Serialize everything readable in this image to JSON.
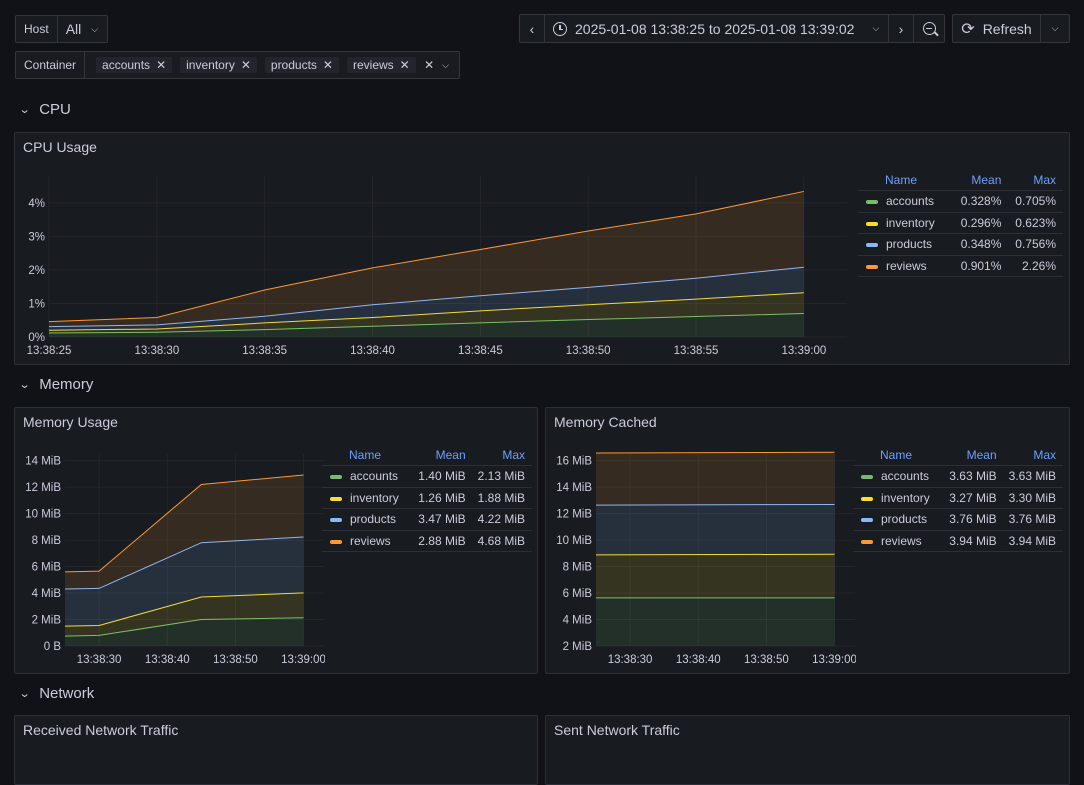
{
  "variables": {
    "host": {
      "label": "Host",
      "value": "All"
    },
    "container": {
      "label": "Container",
      "values": [
        "accounts",
        "inventory",
        "products",
        "reviews"
      ]
    }
  },
  "time_picker": {
    "range": "2025-01-08 13:38:25 to 2025-01-08 13:39:02",
    "refresh_label": "Refresh"
  },
  "colors": {
    "accounts": "#73bf69",
    "inventory": "#fade2a",
    "products": "#8ab8ff",
    "reviews": "#ff9830"
  },
  "sections": {
    "cpu": "CPU",
    "memory": "Memory",
    "network": "Network"
  },
  "legend_headers": {
    "name": "Name",
    "mean": "Mean",
    "max": "Max"
  },
  "panels": {
    "cpu_usage": {
      "title": "CPU Usage",
      "legend": [
        {
          "name": "accounts",
          "mean": "0.328%",
          "max": "0.705%"
        },
        {
          "name": "inventory",
          "mean": "0.296%",
          "max": "0.623%"
        },
        {
          "name": "products",
          "mean": "0.348%",
          "max": "0.756%"
        },
        {
          "name": "reviews",
          "mean": "0.901%",
          "max": "2.26%"
        }
      ]
    },
    "memory_usage": {
      "title": "Memory Usage",
      "legend": [
        {
          "name": "accounts",
          "mean": "1.40 MiB",
          "max": "2.13 MiB"
        },
        {
          "name": "inventory",
          "mean": "1.26 MiB",
          "max": "1.88 MiB"
        },
        {
          "name": "products",
          "mean": "3.47 MiB",
          "max": "4.22 MiB"
        },
        {
          "name": "reviews",
          "mean": "2.88 MiB",
          "max": "4.68 MiB"
        }
      ]
    },
    "memory_cached": {
      "title": "Memory Cached",
      "legend": [
        {
          "name": "accounts",
          "mean": "3.63 MiB",
          "max": "3.63 MiB"
        },
        {
          "name": "inventory",
          "mean": "3.27 MiB",
          "max": "3.30 MiB"
        },
        {
          "name": "products",
          "mean": "3.76 MiB",
          "max": "3.76 MiB"
        },
        {
          "name": "reviews",
          "mean": "3.94 MiB",
          "max": "3.94 MiB"
        }
      ]
    },
    "received_network": {
      "title": "Received Network Traffic"
    },
    "sent_network": {
      "title": "Sent Network Traffic"
    }
  },
  "chart_data": [
    {
      "id": "cpu",
      "type": "area",
      "stacked": true,
      "title": "CPU Usage",
      "x": [
        "13:38:25",
        "13:38:30",
        "13:38:35",
        "13:38:40",
        "13:38:45",
        "13:38:50",
        "13:38:55",
        "13:39:00"
      ],
      "x_ticks": [
        "13:38:25",
        "13:38:30",
        "13:38:35",
        "13:38:40",
        "13:38:45",
        "13:38:50",
        "13:38:55",
        "13:39:00"
      ],
      "y_ticks": [
        "0%",
        "1%",
        "2%",
        "3%",
        "4%"
      ],
      "ylim": [
        0,
        4.8
      ],
      "x_points": [
        0,
        5,
        10,
        15,
        20,
        25,
        30,
        35
      ],
      "xlim": [
        0,
        37
      ],
      "series": [
        {
          "name": "accounts",
          "values": [
            0.12,
            0.14,
            0.22,
            0.32,
            0.42,
            0.52,
            0.61,
            0.7
          ]
        },
        {
          "name": "inventory",
          "values": [
            0.08,
            0.1,
            0.2,
            0.26,
            0.36,
            0.44,
            0.52,
            0.62
          ]
        },
        {
          "name": "products",
          "values": [
            0.11,
            0.12,
            0.2,
            0.38,
            0.45,
            0.52,
            0.62,
            0.76
          ]
        },
        {
          "name": "reviews",
          "values": [
            0.15,
            0.22,
            0.78,
            1.1,
            1.38,
            1.68,
            1.92,
            2.26
          ]
        }
      ]
    },
    {
      "id": "memusage",
      "type": "area",
      "stacked": true,
      "title": "Memory Usage",
      "x_ticks": [
        "13:38:30",
        "13:38:40",
        "13:38:50",
        "13:39:00"
      ],
      "y_ticks": [
        "0 B",
        "2 MiB",
        "4 MiB",
        "6 MiB",
        "8 MiB",
        "10 MiB",
        "12 MiB",
        "14 MiB"
      ],
      "ylim": [
        0,
        14.5
      ],
      "x_points": [
        0,
        5,
        20,
        35
      ],
      "xlim": [
        0,
        38
      ],
      "tick_positions": [
        5,
        15,
        25,
        35
      ],
      "series": [
        {
          "name": "accounts",
          "values": [
            0.75,
            0.8,
            2.0,
            2.13
          ]
        },
        {
          "name": "inventory",
          "values": [
            0.75,
            0.75,
            1.7,
            1.88
          ]
        },
        {
          "name": "products",
          "values": [
            2.8,
            2.8,
            4.1,
            4.22
          ]
        },
        {
          "name": "reviews",
          "values": [
            1.3,
            1.3,
            4.4,
            4.68
          ]
        }
      ]
    },
    {
      "id": "memcached",
      "type": "area",
      "stacked": true,
      "title": "Memory Cached",
      "x_ticks": [
        "13:38:30",
        "13:38:40",
        "13:38:50",
        "13:39:00"
      ],
      "y_ticks": [
        "2 MiB",
        "4 MiB",
        "6 MiB",
        "8 MiB",
        "10 MiB",
        "12 MiB",
        "14 MiB",
        "16 MiB"
      ],
      "ylim": [
        2,
        16.5
      ],
      "x_points": [
        0,
        35
      ],
      "xlim": [
        0,
        38
      ],
      "tick_positions": [
        5,
        15,
        25,
        35
      ],
      "series": [
        {
          "name": "accounts",
          "values": [
            3.63,
            3.63
          ]
        },
        {
          "name": "inventory",
          "values": [
            3.25,
            3.3
          ]
        },
        {
          "name": "products",
          "values": [
            3.76,
            3.76
          ]
        },
        {
          "name": "reviews",
          "values": [
            3.94,
            3.94
          ]
        }
      ]
    }
  ]
}
